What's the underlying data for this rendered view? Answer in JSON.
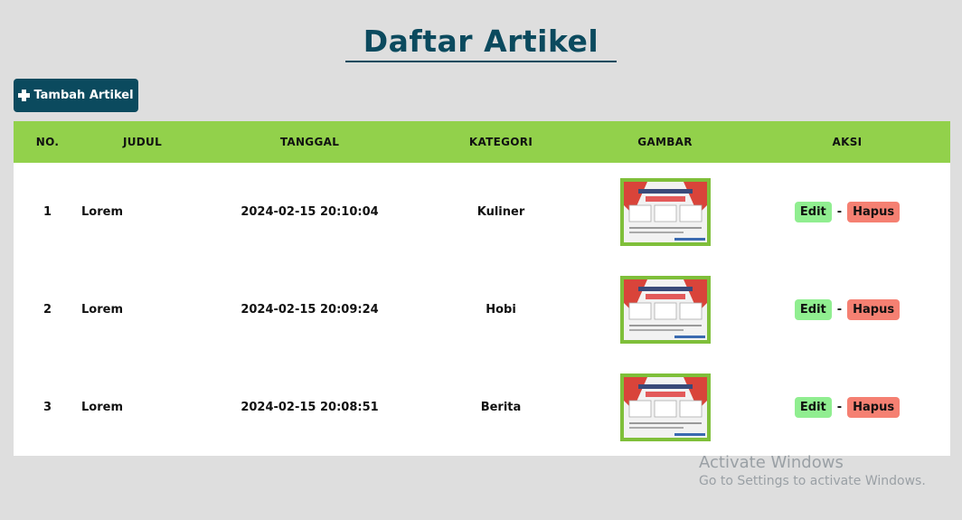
{
  "page": {
    "title": "Daftar Artikel",
    "add_button_label": "Tambah Artikel"
  },
  "table": {
    "headers": {
      "no": "NO.",
      "judul": "JUDUL",
      "tanggal": "TANGGAL",
      "kategori": "KATEGORI",
      "gambar": "GAMBAR",
      "aksi": "AKSI"
    },
    "rows": [
      {
        "no": "1",
        "judul": "Lorem",
        "tanggal": "2024-02-15 20:10:04",
        "kategori": "Kuliner",
        "edit": "Edit",
        "separator": "-",
        "hapus": "Hapus"
      },
      {
        "no": "2",
        "judul": "Lorem",
        "tanggal": "2024-02-15 20:09:24",
        "kategori": "Hobi",
        "edit": "Edit",
        "separator": "-",
        "hapus": "Hapus"
      },
      {
        "no": "3",
        "judul": "Lorem",
        "tanggal": "2024-02-15 20:08:51",
        "kategori": "Berita",
        "edit": "Edit",
        "separator": "-",
        "hapus": "Hapus"
      }
    ]
  },
  "watermark": {
    "title": "Activate Windows",
    "subtitle": "Go to Settings to activate Windows."
  },
  "colors": {
    "primary": "#0b4a5e",
    "header_bg": "#92d14b",
    "edit_bg": "#90ee90",
    "hapus_bg": "#f58072",
    "page_bg": "#dedede"
  }
}
